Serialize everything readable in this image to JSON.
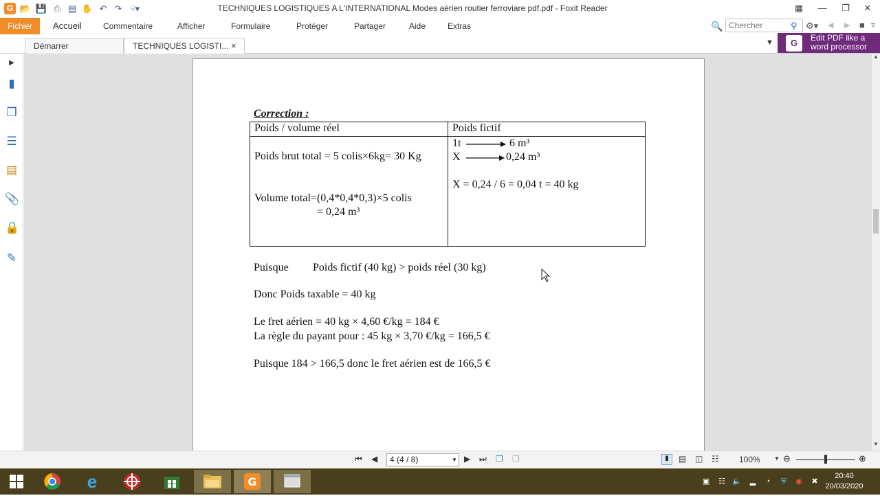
{
  "window": {
    "title": "TECHNIQUES LOGISTIQUES A L'INTERNATIONAL    Modes aérien routier ferroviare pdf.pdf - Foxit Reader",
    "app_icon_letter": "G"
  },
  "ribbon": {
    "file_label": "Fichier",
    "tabs": [
      "Accueil",
      "Commentaire",
      "Afficher",
      "Formulaire",
      "Protéger",
      "Partager",
      "Aide",
      "Extras"
    ],
    "search_placeholder": "Chercher"
  },
  "doc_tabs": [
    {
      "label": "Démarrer"
    },
    {
      "label": "TECHNIQUES LOGISTI...",
      "close": "×"
    }
  ],
  "promo": {
    "line1": "Edit PDF like a",
    "line2": "word processor"
  },
  "document": {
    "correction_title": "Correction :",
    "table": {
      "headers": [
        "Poids / volume réel",
        "Poids fictif"
      ],
      "left": {
        "line1": "Poids brut total = 5 colis×6kg= 30 Kg",
        "line2": "Volume total=(0,4*0,4*0,3)×5 colis",
        "line3": "= 0,24 m³"
      },
      "right": {
        "r1_a": "1t",
        "r1_b": "6 m³",
        "r2_a": "X",
        "r2_b": "0,24 m³",
        "calc": "X = 0,24 / 6 = 0,04 t = 40 kg"
      }
    },
    "puisque_label": "Puisque",
    "puisque_text": "Poids fictif (40 kg)  >  poids réel (30 kg)",
    "donc": "Donc Poids taxable =  40 kg",
    "fret1": "Le fret aérien = 40 kg × 4,60 €/kg = 184 €",
    "fret2": "La règle du payant pour : 45 kg × 3,70 €/kg =  166,5 €",
    "conclusion": "Puisque 184 > 166,5 donc le fret aérien est de 166,5 €"
  },
  "statusbar": {
    "page_value": "4 (4 / 8)",
    "zoom": "100%"
  },
  "taskbar": {
    "time": "20:40",
    "date": "20/03/2020"
  }
}
